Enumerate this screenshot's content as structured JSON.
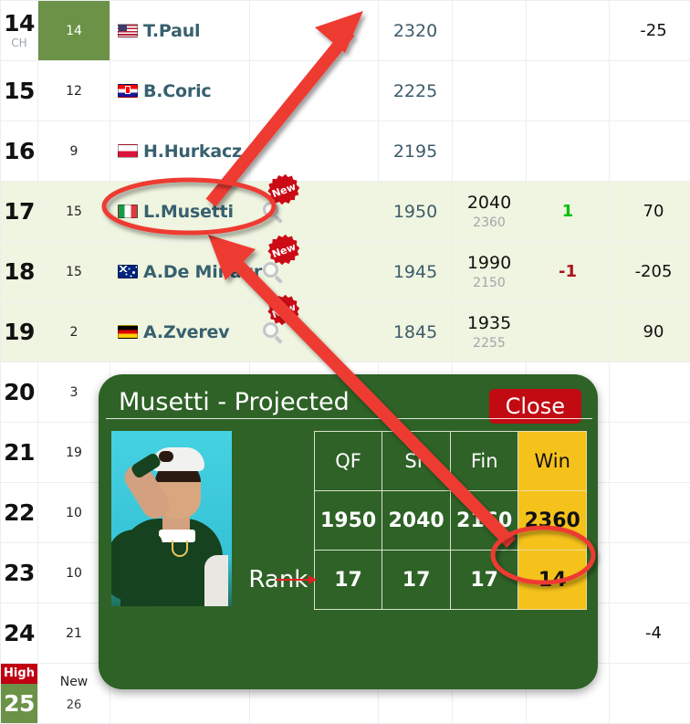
{
  "table": {
    "rows": [
      {
        "rank": "14",
        "rank_sub": "CH",
        "prev": "14",
        "prev_highlight": true,
        "flag": "flag-us",
        "flag_name": "usa-flag",
        "player": "T.Paul",
        "points": "2320",
        "proj": "",
        "proj_sub": "",
        "move": "",
        "change": "-25",
        "highlight": false,
        "new_badge": false,
        "magnifier": false,
        "high_badge": "",
        "green_rank": false
      },
      {
        "rank": "15",
        "rank_sub": "",
        "prev": "12",
        "prev_highlight": false,
        "flag": "flag-hr",
        "flag_name": "croatia-flag",
        "player": "B.Coric",
        "points": "2225",
        "proj": "",
        "proj_sub": "",
        "move": "",
        "change": "",
        "highlight": false,
        "new_badge": false,
        "magnifier": false,
        "high_badge": "",
        "green_rank": false
      },
      {
        "rank": "16",
        "rank_sub": "",
        "prev": "9",
        "prev_highlight": false,
        "flag": "flag-pl",
        "flag_name": "poland-flag",
        "player": "H.Hurkacz",
        "points": "2195",
        "proj": "",
        "proj_sub": "",
        "move": "",
        "change": "",
        "highlight": false,
        "new_badge": false,
        "magnifier": false,
        "high_badge": "",
        "green_rank": false
      },
      {
        "rank": "17",
        "rank_sub": "",
        "prev": "15",
        "prev_highlight": false,
        "flag": "flag-it",
        "flag_name": "italy-flag",
        "player": "L.Musetti",
        "points": "1950",
        "proj": "2040",
        "proj_sub": "2360",
        "move": "1",
        "move_dir": "up",
        "change": "70",
        "highlight": true,
        "new_badge": true,
        "magnifier": true,
        "high_badge": "",
        "green_rank": false
      },
      {
        "rank": "18",
        "rank_sub": "",
        "prev": "15",
        "prev_highlight": false,
        "flag": "flag-au",
        "flag_name": "australia-flag",
        "player": "A.De Minaur",
        "points": "1945",
        "proj": "1990",
        "proj_sub": "2150",
        "move": "-1",
        "move_dir": "down",
        "change": "-205",
        "highlight": true,
        "new_badge": true,
        "magnifier": true,
        "high_badge": "",
        "green_rank": false
      },
      {
        "rank": "19",
        "rank_sub": "",
        "prev": "2",
        "prev_highlight": false,
        "flag": "flag-de",
        "flag_name": "germany-flag",
        "player": "A.Zverev",
        "points": "1845",
        "proj": "1935",
        "proj_sub": "2255",
        "move": "",
        "move_dir": "",
        "change": "90",
        "highlight": true,
        "new_badge": true,
        "magnifier": true,
        "high_badge": "",
        "green_rank": false
      },
      {
        "rank": "20",
        "rank_sub": "",
        "prev": "3",
        "prev_highlight": false,
        "flag": "",
        "flag_name": "",
        "player": "",
        "points": "",
        "proj": "",
        "proj_sub": "",
        "move": "",
        "change": "",
        "highlight": false,
        "new_badge": false,
        "magnifier": false,
        "high_badge": "",
        "green_rank": false
      },
      {
        "rank": "21",
        "rank_sub": "",
        "prev": "19",
        "prev_highlight": false,
        "flag": "",
        "flag_name": "",
        "player": "",
        "points": "",
        "proj": "",
        "proj_sub": "",
        "move": "",
        "change": "",
        "highlight": false,
        "new_badge": false,
        "magnifier": false,
        "high_badge": "",
        "green_rank": false
      },
      {
        "rank": "22",
        "rank_sub": "",
        "prev": "10",
        "prev_highlight": false,
        "flag": "",
        "flag_name": "",
        "player": "",
        "points": "",
        "proj": "",
        "proj_sub": "",
        "move": "",
        "change": "",
        "highlight": false,
        "new_badge": false,
        "magnifier": false,
        "high_badge": "",
        "green_rank": false
      },
      {
        "rank": "23",
        "rank_sub": "",
        "prev": "10",
        "prev_highlight": false,
        "flag": "",
        "flag_name": "",
        "player": "",
        "points": "",
        "proj": "",
        "proj_sub": "",
        "move": "",
        "change": "",
        "highlight": false,
        "new_badge": false,
        "magnifier": false,
        "high_badge": "",
        "green_rank": false
      },
      {
        "rank": "24",
        "rank_sub": "",
        "prev": "21",
        "prev_highlight": false,
        "flag": "",
        "flag_name": "",
        "player": "",
        "points": "",
        "proj": "",
        "proj_sub": "",
        "move": "",
        "change": "-4",
        "highlight": false,
        "new_badge": false,
        "magnifier": false,
        "high_badge": "",
        "green_rank": false
      },
      {
        "rank": "25",
        "rank_sub": "",
        "prev": "New",
        "prev_sub": "26",
        "prev_highlight": false,
        "flag": "",
        "flag_name": "",
        "player": "",
        "points": "",
        "proj": "",
        "proj_sub": "",
        "move": "",
        "change": "",
        "highlight": false,
        "new_badge": false,
        "magnifier": false,
        "high_badge": "High",
        "green_rank": true
      }
    ],
    "new_badge_label": "New"
  },
  "popup": {
    "title": "Musetti - Projected",
    "close_label": "Close",
    "row_label": "Rank",
    "headers": [
      "QF",
      "SF",
      "Fin",
      "Win"
    ],
    "points": [
      "1950",
      "2040",
      "2160",
      "2360"
    ],
    "ranks": [
      "17",
      "17",
      "17",
      "14"
    ]
  },
  "colors": {
    "popup_green": "#2e6226",
    "win_gold": "#f5c21b",
    "close_red": "#c20a12",
    "row_highlight": "#eff5e0",
    "rank_green": "#6b9247",
    "high_red": "#c00011",
    "annotation_red": "#ee3b33",
    "move_up_green": "#00c000",
    "move_down_red": "#a8141e"
  }
}
